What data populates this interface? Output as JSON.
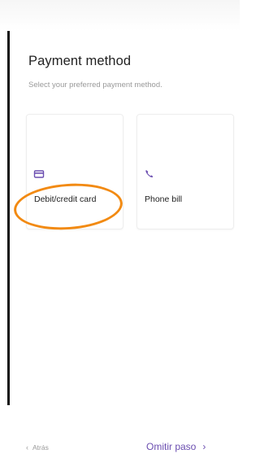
{
  "header": {
    "title": "Payment method",
    "subtitle": "Select your preferred payment method."
  },
  "options": [
    {
      "label": "Debit/credit card",
      "icon": "credit-card-icon"
    },
    {
      "label": "Phone bill",
      "icon": "phone-icon"
    }
  ],
  "footer": {
    "back_chevron": "‹",
    "back_label": "Atrás",
    "skip_label": "Omitir paso",
    "skip_chevron": "›"
  },
  "colors": {
    "accent": "#6b4eb0",
    "annotation": "#f28a12"
  }
}
